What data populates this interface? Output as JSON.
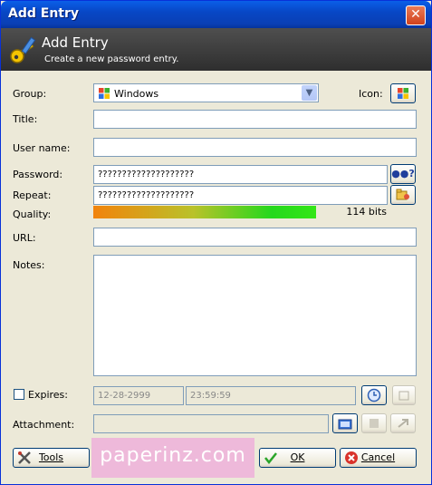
{
  "window": {
    "title": "Add Entry",
    "close_glyph": "✕"
  },
  "header": {
    "title": "Add Entry",
    "subtitle": "Create a new password entry.",
    "icon": "key-pencil-icon"
  },
  "form": {
    "group_label": "Group:",
    "group_value": "Windows",
    "icon_label": "Icon:",
    "title_label": "Title:",
    "title_value": "",
    "username_label": "User name:",
    "username_value": "",
    "password_label": "Password:",
    "password_value": "????????????????????",
    "show_password_glyph": "●●?",
    "repeat_label": "Repeat:",
    "repeat_value": "????????????????????",
    "quality_label": "Quality:",
    "quality_text": "114 bits",
    "quality_fraction": 0.69,
    "url_label": "URL:",
    "url_value": "",
    "notes_label": "Notes:",
    "notes_value": "",
    "expires_label": "Expires:",
    "expires_checked": false,
    "expires_date": "12-28-2999",
    "expires_time": "23:59:59",
    "attachment_label": "Attachment:",
    "attachment_value": ""
  },
  "buttons": {
    "tools": "Tools",
    "ok": "OK",
    "cancel": "Cancel"
  },
  "watermark": "paperinz.com",
  "colors": {
    "titlebar": "#0a5fe8",
    "header_bg": "#3a3a3a",
    "dialog_bg": "#ece9d8",
    "quality_start": "#f2830c",
    "quality_end": "#33e617"
  }
}
